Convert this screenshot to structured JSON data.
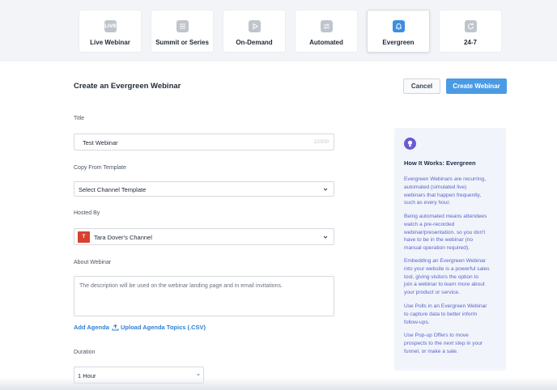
{
  "webinar_types": [
    {
      "label": "Live Webinar",
      "icon": "live-icon",
      "active": false
    },
    {
      "label": "Summit or Series",
      "icon": "list-icon",
      "active": false
    },
    {
      "label": "On-Demand",
      "icon": "play-icon",
      "active": false
    },
    {
      "label": "Automated",
      "icon": "repeat-icon",
      "active": false
    },
    {
      "label": "Evergreen",
      "icon": "bell-icon",
      "active": true
    },
    {
      "label": "24-7",
      "icon": "refresh-icon",
      "active": false
    }
  ],
  "live_icon_text": "LIVE",
  "header": {
    "title": "Create an Evergreen Webinar",
    "cancel_label": "Cancel",
    "create_label": "Create Webinar"
  },
  "form": {
    "title_label": "Title",
    "title_value": "Test Webinar",
    "title_counter": "12/200",
    "template_label": "Copy From Template",
    "template_value": "Select Channel Template",
    "hosted_label": "Hosted By",
    "hosted_initial": "T",
    "hosted_value": "Tara Dover's Channel",
    "about_label": "About Webinar",
    "about_placeholder": "The description will be used on the webinar landing page and in email invitations.",
    "add_agenda": "Add Agenda",
    "upload_agenda": "Upload Agenda Topics (.CSV)",
    "duration_label": "Duration",
    "duration_value": "1 Hour"
  },
  "info": {
    "title": "How It Works: Evergreen",
    "paragraphs": [
      [
        "Evergreen Webinars are recurring,",
        "automated (simulated live)",
        "webinars that happen frequently,",
        "such as every hour."
      ],
      [
        "Being automated means attendees",
        "watch a pre-recorded",
        "webinar/presentation, so you don't",
        "have to be in the webinar (no",
        "manual operation required)."
      ],
      [
        "Embedding an Evergreen Webinar",
        "into your website is a powerful sales",
        "tool, giving visitors the option to",
        "join a webinar to learn more about",
        "your product or service."
      ],
      [
        "Use Polls in an Evergreen Webinar",
        "to capture data to better inform",
        "follow-ups."
      ],
      [
        "Use Pop-up Offers to move",
        "prospects to the next step in your",
        "funnel, or make a sale."
      ]
    ]
  },
  "colors": {
    "accent": "#4a9be4",
    "link": "#2f80d1",
    "info_text": "#5b63c8",
    "info_icon": "#6a5bd3",
    "avatar": "#d9412e"
  }
}
